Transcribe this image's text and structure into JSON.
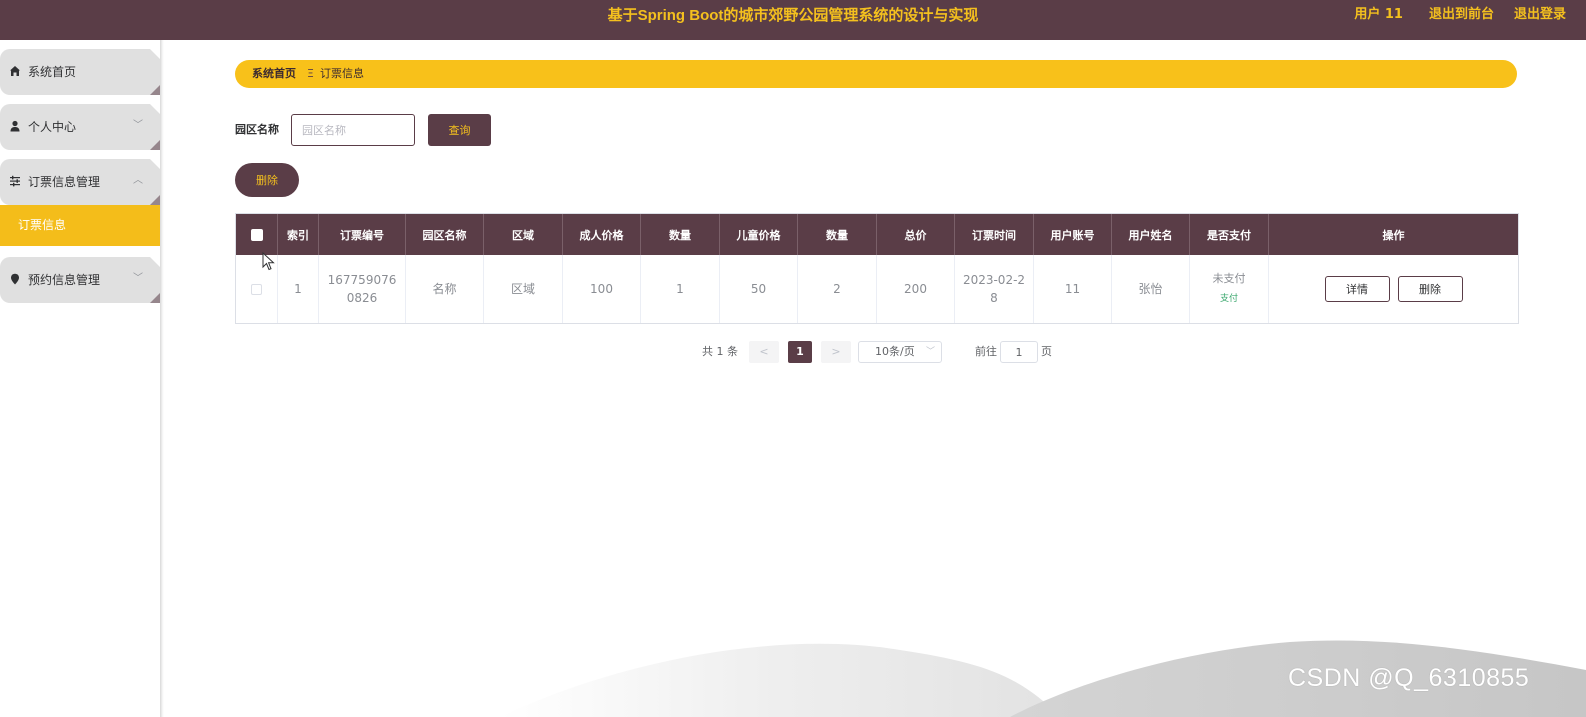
{
  "header": {
    "title": "基于Spring Boot的城市郊野公园管理系统的设计与实现",
    "user": "用户 11",
    "back_to_front": "退出到前台",
    "logout": "退出登录",
    "bg_color": "#5a3d47",
    "accent_color": "#f4c01e"
  },
  "sidebar": {
    "items": [
      {
        "label": "系统首页",
        "icon": "home-icon"
      },
      {
        "label": "个人中心",
        "icon": "user-icon",
        "chevron": "down"
      },
      {
        "label": "订票信息管理",
        "icon": "sliders-icon",
        "chevron": "up"
      },
      {
        "label": "预约信息管理",
        "icon": "location-icon",
        "chevron": "down"
      }
    ],
    "active_sub": "订票信息",
    "active_color": "#f4bd1a"
  },
  "breadcrumb": {
    "home": "系统首页",
    "separator": "Ξ",
    "current": "订票信息"
  },
  "search": {
    "label": "园区名称",
    "placeholder": "园区名称",
    "value": "",
    "query_button": "查询",
    "delete_button": "删除"
  },
  "table": {
    "columns": [
      "索引",
      "订票编号",
      "园区名称",
      "区域",
      "成人价格",
      "数量",
      "儿童价格",
      "数量",
      "总价",
      "订票时间",
      "用户账号",
      "用户姓名",
      "是否支付",
      "操作"
    ],
    "rows": [
      {
        "index": "1",
        "ticket_no_line1": "167759076",
        "ticket_no_line2": "0826",
        "park_name": "名称",
        "area": "区域",
        "adult_price": "100",
        "adult_qty": "1",
        "child_price": "50",
        "child_qty": "2",
        "total": "200",
        "time_line1": "2023-02-2",
        "time_line2": "8",
        "account": "11",
        "name": "张怡",
        "pay_state": "未支付",
        "pay_action": "支付",
        "detail_button": "详情",
        "delete_button": "删除"
      }
    ]
  },
  "pagination": {
    "total": "共 1 条",
    "prev": "<",
    "current_page": "1",
    "next": ">",
    "page_size": "10条/页",
    "goto_label": "前往",
    "goto_value": "1",
    "page_suffix": "页"
  },
  "watermark": "CSDN @Q_6310855"
}
